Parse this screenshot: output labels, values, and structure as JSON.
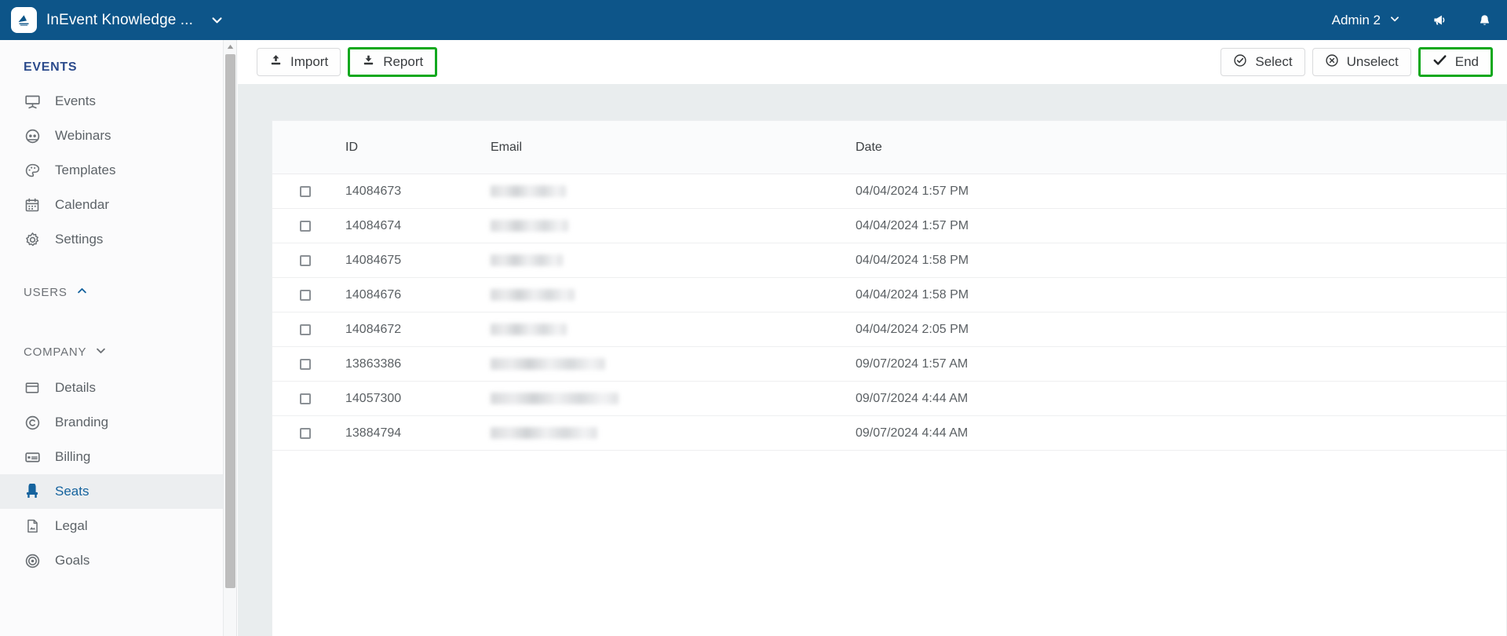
{
  "topbar": {
    "brand_name": "InEvent Knowledge ...",
    "brand_logo_icon": "inevent-logo-icon",
    "brand_caret_icon": "chevron-down-icon",
    "admin_label": "Admin 2",
    "admin_caret_icon": "chevron-down-icon",
    "announcement_icon": "megaphone-icon",
    "notification_icon": "bell-icon",
    "background_color": "#0d5589"
  },
  "sidebar": {
    "events_section_label": "EVENTS",
    "events_items": [
      {
        "label": "Events",
        "icon": "presentation-screen-icon"
      },
      {
        "label": "Webinars",
        "icon": "webinar-headset-icon"
      },
      {
        "label": "Templates",
        "icon": "palette-icon"
      },
      {
        "label": "Calendar",
        "icon": "calendar-icon"
      },
      {
        "label": "Settings",
        "icon": "gear-icon"
      }
    ],
    "users_group_label": "USERS",
    "users_group_caret_icon": "chevron-up-icon",
    "company_group_label": "COMPANY",
    "company_group_caret_icon": "chevron-down-icon",
    "company_items": [
      {
        "label": "Details",
        "icon": "window-icon",
        "active": false
      },
      {
        "label": "Branding",
        "icon": "copyright-icon",
        "active": false
      },
      {
        "label": "Billing",
        "icon": "credit-card-icon",
        "active": false
      },
      {
        "label": "Seats",
        "icon": "seat-chair-icon",
        "active": true
      },
      {
        "label": "Legal",
        "icon": "document-image-icon",
        "active": false
      },
      {
        "label": "Goals",
        "icon": "target-icon",
        "active": false
      }
    ],
    "active_item_color": "#15639e",
    "section_title_color": "#2c4b8c"
  },
  "toolbar": {
    "left_buttons": [
      {
        "label": "Import",
        "icon": "upload-icon",
        "highlighted": false
      },
      {
        "label": "Report",
        "icon": "download-icon",
        "highlighted": true
      }
    ],
    "right_buttons": [
      {
        "label": "Select",
        "icon": "check-circle-icon",
        "highlighted": false
      },
      {
        "label": "Unselect",
        "icon": "x-circle-icon",
        "highlighted": false
      },
      {
        "label": "End",
        "icon": "checkmark-icon",
        "highlighted": true
      }
    ],
    "highlight_color": "#11a81e"
  },
  "table": {
    "columns": [
      "",
      "ID",
      "Email",
      "Date"
    ],
    "rows": [
      {
        "id": "14084673",
        "email": "",
        "date": "04/04/2024 1:57 PM",
        "checked": false
      },
      {
        "id": "14084674",
        "email": "",
        "date": "04/04/2024 1:57 PM",
        "checked": false
      },
      {
        "id": "14084675",
        "email": "",
        "date": "04/04/2024 1:58 PM",
        "checked": false
      },
      {
        "id": "14084676",
        "email": "",
        "date": "04/04/2024 1:58 PM",
        "checked": false
      },
      {
        "id": "14084672",
        "email": "",
        "date": "04/04/2024 2:05 PM",
        "checked": false
      },
      {
        "id": "13863386",
        "email": "",
        "date": "09/07/2024 1:57 AM",
        "checked": false
      },
      {
        "id": "14057300",
        "email": "",
        "date": "09/07/2024 4:44 AM",
        "checked": false
      },
      {
        "id": "13884794",
        "email": "",
        "date": "09/07/2024 4:44 AM",
        "checked": false
      }
    ],
    "redacted_widths": [
      96,
      99,
      92,
      107,
      97,
      146,
      163,
      136
    ]
  }
}
